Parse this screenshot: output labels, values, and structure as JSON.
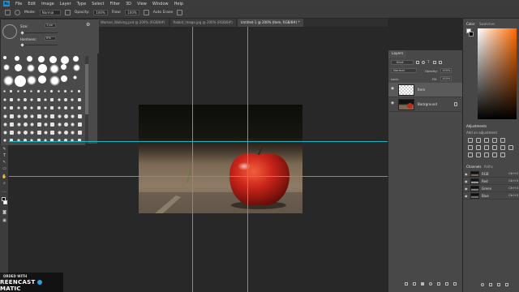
{
  "menu": {
    "logo": "Ps",
    "items": [
      "File",
      "Edit",
      "Image",
      "Layer",
      "Type",
      "Select",
      "Filter",
      "3D",
      "View",
      "Window",
      "Help"
    ]
  },
  "options_bar": {
    "mode_label": "Mode:",
    "mode_value": "Normal",
    "opacity_label": "Opacity:",
    "opacity_value": "100%",
    "flow_label": "Flow:",
    "flow_value": "100%",
    "auto_erase_label": "Auto Erase"
  },
  "tabs": [
    {
      "label": "Woman_Walking.psd @ 200% (RGB/8#)",
      "active": false
    },
    {
      "label": "Rabbit_Image.jpg @ 200% (RGB/8#)",
      "active": false
    },
    {
      "label": "Untitled-1 @ 200% (Item, RGB/8#) *",
      "active": true
    }
  ],
  "brush_panel": {
    "size_label": "Size:",
    "size_value": "1 px",
    "hardness_label": "Hardness:",
    "hardness_value": "0%"
  },
  "layers_panel": {
    "tab": "Layers",
    "kind_label": "Kind",
    "blend_mode": "Normal",
    "opacity_label": "Opacity:",
    "opacity_value": "100%",
    "lock_label": "Lock:",
    "fill_label": "Fill:",
    "fill_value": "100%",
    "layers": [
      {
        "name": "Item",
        "selected": true,
        "thumb": "transparent"
      },
      {
        "name": "Background",
        "selected": false,
        "thumb": "apple"
      }
    ]
  },
  "color_panel": {
    "tabs": [
      "Color",
      "Swatches"
    ],
    "hue_color": "#ff6a00"
  },
  "adjustments_panel": {
    "title": "Adjustments",
    "subtitle": "Add an adjustment"
  },
  "channels_panel": {
    "tabs": [
      "Channels",
      "Paths"
    ],
    "channels": [
      {
        "name": "RGB",
        "key": "Ctrl+2"
      },
      {
        "name": "Red",
        "key": "Ctrl+3"
      },
      {
        "name": "Green",
        "key": "Ctrl+4"
      },
      {
        "name": "Blue",
        "key": "Ctrl+5"
      }
    ]
  },
  "status": {
    "zoom": "200%"
  },
  "watermark": {
    "line1": "ORDED WITH",
    "line2a": "REENCAST",
    "line2b": "MATIC"
  },
  "colors": {
    "guide": "#1fb6c2",
    "accent": "#1f8fd6"
  }
}
